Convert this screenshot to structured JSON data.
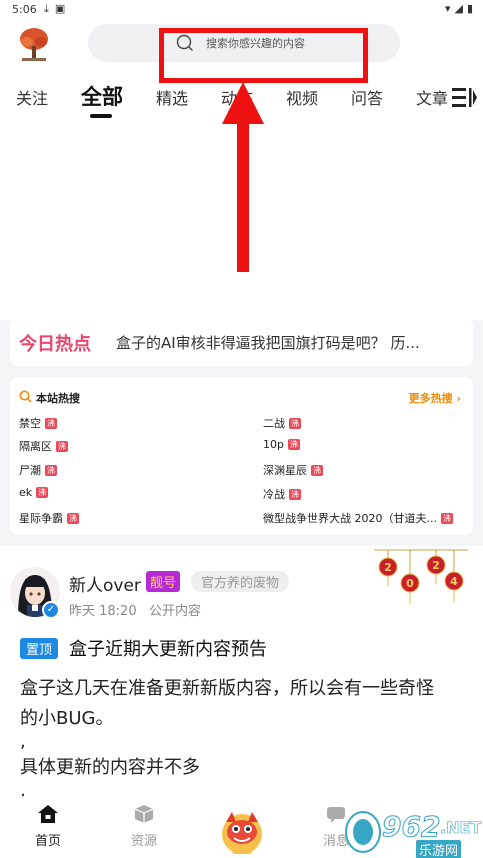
{
  "status_bar": {
    "time": "5:06"
  },
  "search": {
    "placeholder": "搜索你感兴趣的内容"
  },
  "tabs": [
    "关注",
    "全部",
    "精选",
    "动态",
    "视频",
    "问答",
    "文章"
  ],
  "active_tab": "全部",
  "hot": {
    "title": "今日热点",
    "text": "盒子的AI审核非得逼我把国旗打码是吧？ 历..."
  },
  "site_search": {
    "title": "本站热搜",
    "more": "更多热搜",
    "badge": "沸",
    "left": [
      "禁空",
      "隔离区",
      "尸潮",
      "ek",
      "星际争霸"
    ],
    "right": [
      "二战",
      "10p",
      "深渊星辰",
      "冷战",
      "微型战争世界大战 2020（甘道夫..."
    ]
  },
  "post": {
    "username": "新人over",
    "tag_pretty": "靓号",
    "tag_title": "官方养的废物",
    "time": "昨天 18:20",
    "visibility": "公开内容",
    "pin_label": "置顶",
    "title": "盒子近期大更新内容预告",
    "lines": [
      "盒子这几天在准备更新新版内容，所以会有一些奇怪",
      "的小BUG。",
      ",",
      "具体更新的内容并不多",
      ","
    ],
    "decor_digits": [
      "2",
      "0",
      "2",
      "4"
    ]
  },
  "bottom_nav": {
    "items": [
      {
        "label": "首页",
        "icon": "home-icon"
      },
      {
        "label": "资源",
        "icon": "box-icon"
      },
      {
        "label": "消息",
        "icon": "message-icon"
      }
    ]
  },
  "watermark": {
    "number": "962",
    "net": ".NET",
    "cn": "乐游网"
  },
  "colors": {
    "accent_pink": "#e8466a",
    "hot_badge": "#e94a5a",
    "more_orange": "#f08a00",
    "pin_blue": "#1e88e5",
    "annotation_red": "#ee1111"
  }
}
